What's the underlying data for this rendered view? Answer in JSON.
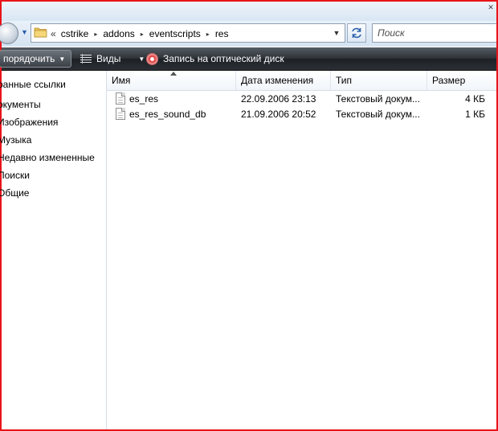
{
  "address": {
    "overflow_chevron": "«",
    "crumbs": [
      "cstrike",
      "addons",
      "eventscripts",
      "res"
    ],
    "crumb_separator": "▸"
  },
  "search": {
    "placeholder": "Поиск"
  },
  "toolbar": {
    "organize_label": "порядочить",
    "views_label": "Виды",
    "burn_label": "Запись на оптический диск"
  },
  "sidebar": {
    "items": [
      {
        "label": "ранные ссылки"
      },
      {
        "label": "окументы"
      },
      {
        "label": "Изображения"
      },
      {
        "label": "Музыка"
      },
      {
        "label": "Недавно измененные"
      },
      {
        "label": "Поиски"
      },
      {
        "label": "Общие"
      }
    ]
  },
  "columns": {
    "name": "Имя",
    "date": "Дата изменения",
    "type": "Тип",
    "size": "Размер"
  },
  "files": [
    {
      "name": "es_res",
      "date": "22.09.2006 23:13",
      "type": "Текстовый докум...",
      "size": "4 КБ"
    },
    {
      "name": "es_res_sound_db",
      "date": "21.09.2006 20:52",
      "type": "Текстовый докум...",
      "size": "1 КБ"
    }
  ],
  "colors": {
    "frame_border": "#e8141a",
    "toolbar_bg": "#2e3338",
    "accent": "#2a5fa8"
  }
}
